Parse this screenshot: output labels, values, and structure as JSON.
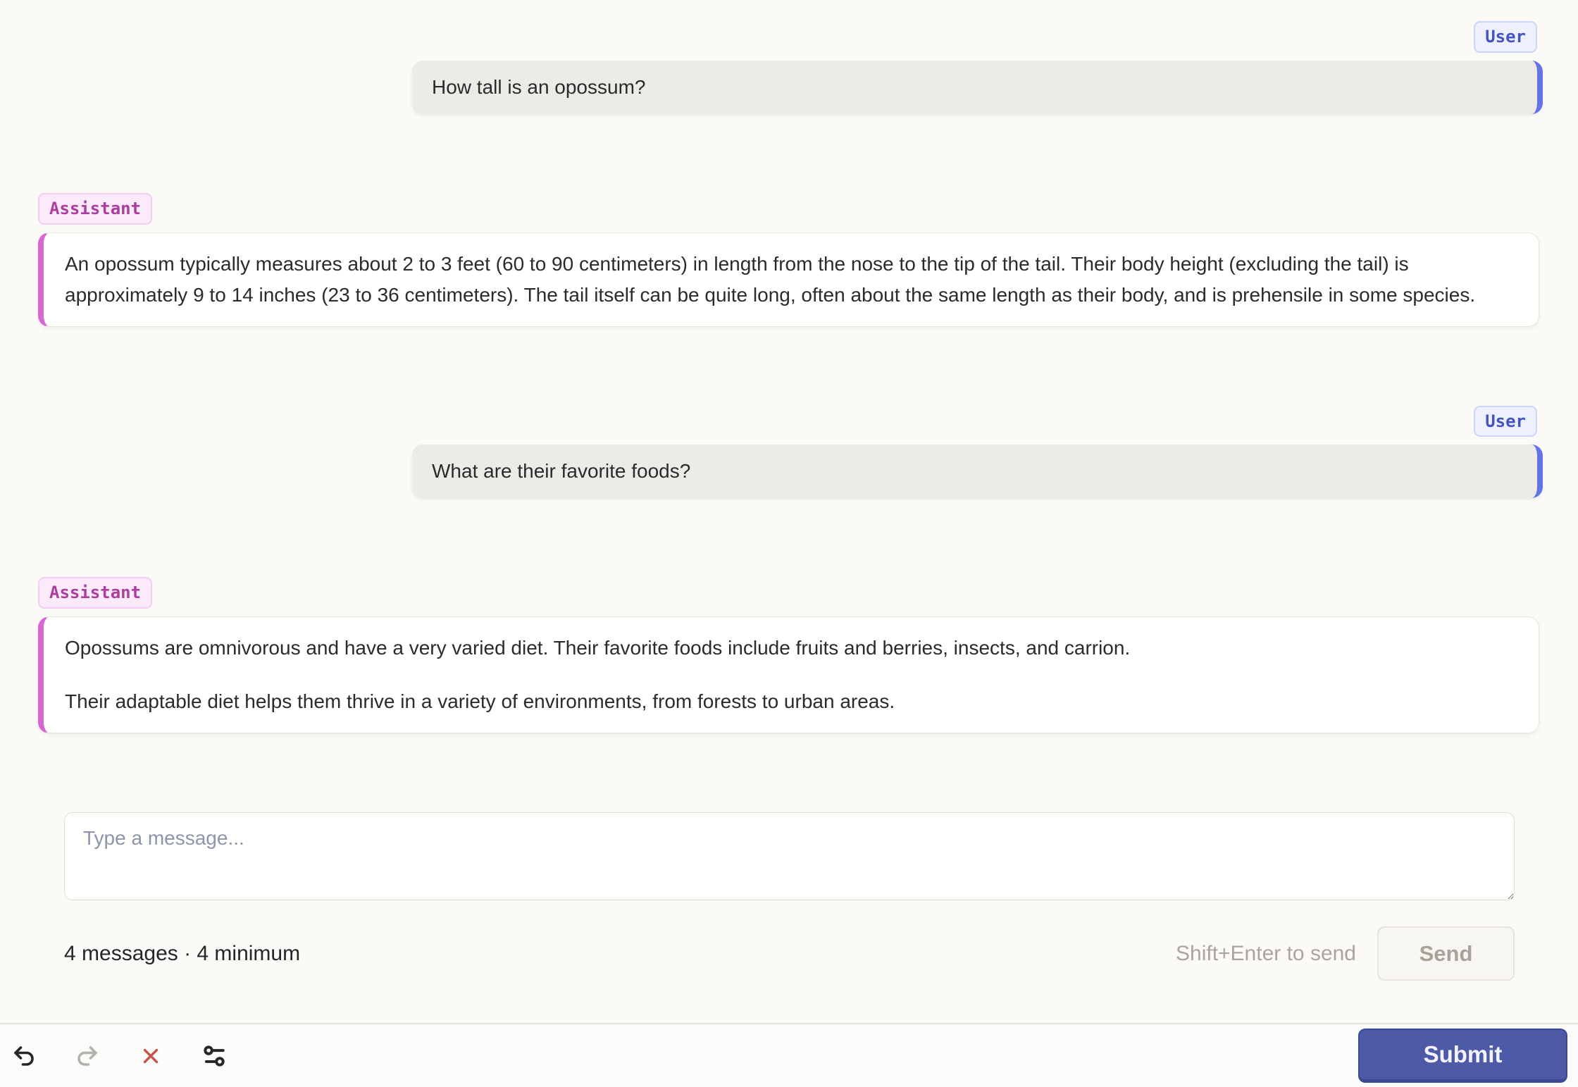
{
  "conversation": {
    "messages": [
      {
        "role": "User",
        "text": "How tall is an opossum?"
      },
      {
        "role": "Assistant",
        "paragraphs": [
          "An opossum typically measures about 2 to 3 feet (60 to 90 centimeters) in length from the nose to the tip of the tail. Their body height (excluding the tail) is approximately 9 to 14 inches (23 to 36 centimeters). The tail itself can be quite long, often about the same length as their body, and is prehensile in some species."
        ]
      },
      {
        "role": "User",
        "text": "What are their favorite foods?"
      },
      {
        "role": "Assistant",
        "paragraphs": [
          "Opossums are omnivorous and have a very varied diet. Their favorite foods include fruits and berries, insects, and carrion.",
          "Their adaptable diet helps them thrive in a variety of environments, from forests to urban areas."
        ]
      }
    ]
  },
  "composer": {
    "placeholder": "Type a message...",
    "message_count": "4 messages · 4 minimum",
    "send_hint": "Shift+Enter to send",
    "send_label": "Send"
  },
  "toolbar": {
    "submit_label": "Submit",
    "icons": [
      "undo-icon",
      "redo-icon",
      "close-icon",
      "sliders-icon"
    ]
  },
  "colors": {
    "page_background": "#fbfaf7",
    "user_accent": "#6473e6",
    "user_bubble_bg": "#ecebe6",
    "user_badge_text": "#4554c4",
    "assistant_accent": "#d868cf",
    "assistant_badge_text": "#ab3d9e",
    "submit_bg": "#4c5aa7",
    "clear_icon_red": "#c25449",
    "disabled_gray": "#b5b2ab"
  }
}
